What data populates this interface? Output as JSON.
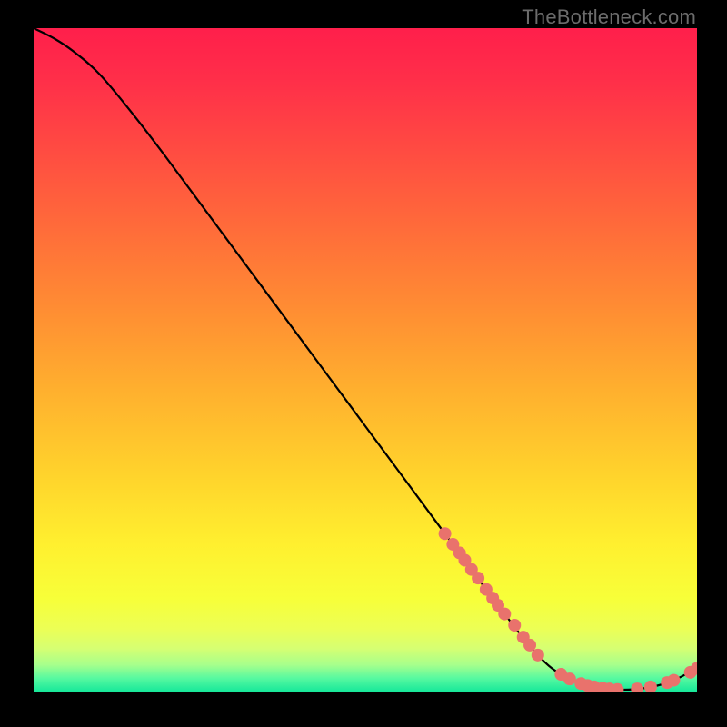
{
  "watermark": "TheBottleneck.com",
  "chart_data": {
    "type": "line",
    "title": "",
    "xlabel": "",
    "ylabel": "",
    "xlim": [
      0,
      100
    ],
    "ylim": [
      0,
      100
    ],
    "curve": [
      {
        "x": 0,
        "y": 100
      },
      {
        "x": 3,
        "y": 98.5
      },
      {
        "x": 6,
        "y": 96.5
      },
      {
        "x": 10,
        "y": 93
      },
      {
        "x": 15,
        "y": 87
      },
      {
        "x": 20,
        "y": 80.5
      },
      {
        "x": 30,
        "y": 67
      },
      {
        "x": 40,
        "y": 53.5
      },
      {
        "x": 50,
        "y": 40
      },
      {
        "x": 60,
        "y": 26.5
      },
      {
        "x": 70,
        "y": 13
      },
      {
        "x": 76,
        "y": 5.5
      },
      {
        "x": 80,
        "y": 2.3
      },
      {
        "x": 84,
        "y": 0.8
      },
      {
        "x": 88,
        "y": 0.3
      },
      {
        "x": 92,
        "y": 0.5
      },
      {
        "x": 96,
        "y": 1.5
      },
      {
        "x": 100,
        "y": 3.5
      }
    ],
    "highlight_points": [
      {
        "x": 62.0,
        "y": 23.8
      },
      {
        "x": 63.2,
        "y": 22.2
      },
      {
        "x": 64.2,
        "y": 20.9
      },
      {
        "x": 65.0,
        "y": 19.8
      },
      {
        "x": 66.0,
        "y": 18.4
      },
      {
        "x": 67.0,
        "y": 17.1
      },
      {
        "x": 68.2,
        "y": 15.4
      },
      {
        "x": 69.2,
        "y": 14.1
      },
      {
        "x": 70.0,
        "y": 13.0
      },
      {
        "x": 71.0,
        "y": 11.7
      },
      {
        "x": 72.5,
        "y": 10.0
      },
      {
        "x": 73.8,
        "y": 8.2
      },
      {
        "x": 74.8,
        "y": 7.0
      },
      {
        "x": 76.0,
        "y": 5.5
      },
      {
        "x": 79.5,
        "y": 2.6
      },
      {
        "x": 80.8,
        "y": 1.9
      },
      {
        "x": 82.5,
        "y": 1.2
      },
      {
        "x": 83.5,
        "y": 0.9
      },
      {
        "x": 84.5,
        "y": 0.7
      },
      {
        "x": 85.8,
        "y": 0.5
      },
      {
        "x": 86.8,
        "y": 0.4
      },
      {
        "x": 88.0,
        "y": 0.3
      },
      {
        "x": 91.0,
        "y": 0.4
      },
      {
        "x": 93.0,
        "y": 0.7
      },
      {
        "x": 95.5,
        "y": 1.35
      },
      {
        "x": 96.5,
        "y": 1.7
      },
      {
        "x": 99.0,
        "y": 2.9
      },
      {
        "x": 100.0,
        "y": 3.5
      }
    ],
    "gradient_stops": [
      {
        "pos": 0.0,
        "color": "#ff1f4b"
      },
      {
        "pos": 0.08,
        "color": "#ff2f49"
      },
      {
        "pos": 0.18,
        "color": "#ff4a42"
      },
      {
        "pos": 0.3,
        "color": "#ff6b3a"
      },
      {
        "pos": 0.42,
        "color": "#ff8c33"
      },
      {
        "pos": 0.55,
        "color": "#ffb12e"
      },
      {
        "pos": 0.68,
        "color": "#ffd52c"
      },
      {
        "pos": 0.78,
        "color": "#fff02f"
      },
      {
        "pos": 0.86,
        "color": "#f7ff39"
      },
      {
        "pos": 0.905,
        "color": "#ecff55"
      },
      {
        "pos": 0.935,
        "color": "#d6ff72"
      },
      {
        "pos": 0.96,
        "color": "#a6ff8c"
      },
      {
        "pos": 0.98,
        "color": "#57f9a0"
      },
      {
        "pos": 1.0,
        "color": "#17e89a"
      }
    ],
    "dot_color": "#e9726c",
    "line_color": "#000000"
  }
}
